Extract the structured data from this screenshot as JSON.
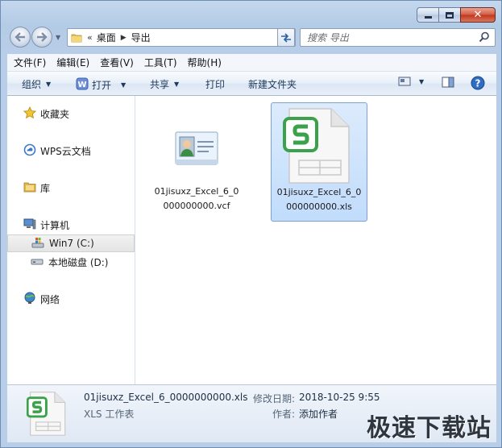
{
  "window": {
    "controls": {
      "minimize": "minimize",
      "maximize": "maximize",
      "close": "✕"
    }
  },
  "nav": {
    "breadcrumb_overflow": "«",
    "breadcrumb": [
      "桌面",
      "导出"
    ],
    "search_placeholder": "搜索 导出"
  },
  "menu": [
    "文件(F)",
    "编辑(E)",
    "查看(V)",
    "工具(T)",
    "帮助(H)"
  ],
  "toolbar": {
    "organize": "组织",
    "open": "打开",
    "share": "共享",
    "print": "打印",
    "new_folder": "新建文件夹"
  },
  "sidebar": {
    "favorites": "收藏夹",
    "wps_cloud": "WPS云文档",
    "library": "库",
    "computer": "计算机",
    "drive_c": "Win7 (C:)",
    "drive_d": "本地磁盘 (D:)",
    "network": "网络"
  },
  "files": [
    {
      "name": "01jisuxz_Excel_6_0000000000.vcf",
      "line1": "01jisuxz_Excel_6_0",
      "line2": "000000000.vcf",
      "type": "vcf-contact-icon",
      "selected": false
    },
    {
      "name": "01jisuxz_Excel_6_0000000000.xls",
      "line1": "01jisuxz_Excel_6_0",
      "line2": "000000000.xls",
      "type": "wps-spreadsheet-icon",
      "selected": true
    }
  ],
  "details": {
    "filename": "01jisuxz_Excel_6_0000000000.xls",
    "filetype": "XLS 工作表",
    "modified_label": "修改日期:",
    "modified_value": "2018-10-25 9:55",
    "author_label": "作者:",
    "author_value": "添加作者"
  },
  "watermark": "极速下载站",
  "colors": {
    "wps_green": "#3aa24a",
    "selection_blue": "#c1dcfc",
    "toolbar_text": "#1e395b"
  }
}
